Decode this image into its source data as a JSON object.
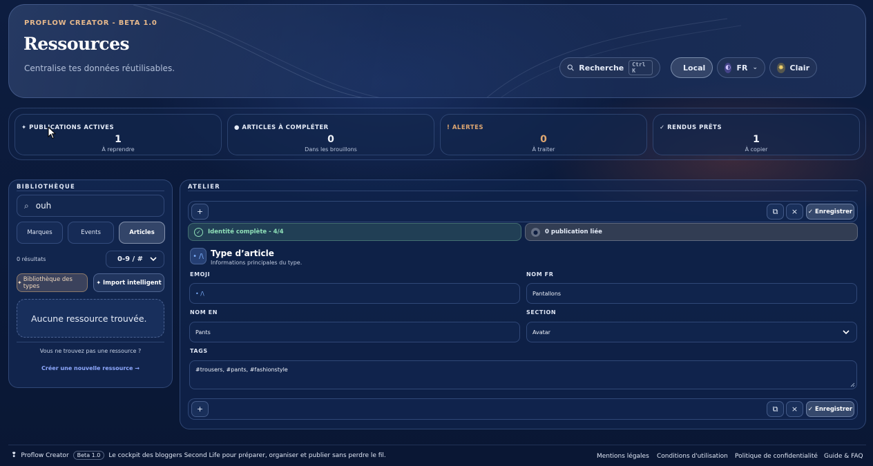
{
  "header": {
    "eyebrow": "PROFLOW CREATOR - BETA 1.0",
    "title": "Ressources",
    "subtitle": "Centralise tes données réutilisables.",
    "search_label": "Recherche",
    "search_shortcut": "Ctrl K",
    "mode_label": "Local",
    "lang_label": "FR",
    "theme_label": "Clair"
  },
  "stats": [
    {
      "label": "PUBLICATIONS ACTIVES",
      "value": "1",
      "sub": "À reprendre",
      "icon": "sparkle-icon",
      "color": "#f1f4fa"
    },
    {
      "label": "ARTICLES À COMPLÉTER",
      "value": "0",
      "sub": "Dans les brouillons",
      "icon": "info-icon",
      "color": "#f1f4fa"
    },
    {
      "label": "ALERTES",
      "value": "0",
      "sub": "À traiter",
      "icon": "alert-icon",
      "color": "#e0a872"
    },
    {
      "label": "RENDUS PRÊTS",
      "value": "1",
      "sub": "À copier",
      "icon": "check-icon",
      "color": "#f1f4fa"
    }
  ],
  "library": {
    "title": "BIBLIOTHÈQUE",
    "search_value": "ouh",
    "tabs": [
      "Marques",
      "Events",
      "Articles"
    ],
    "active_tab": "Articles",
    "result_count": "0 résultats",
    "sort_value": "0-9 / #",
    "types_button": "Bibliothèque des types",
    "import_button": "Import intelligent",
    "empty_text": "Aucune ressource trouvée.",
    "hint": "Vous ne trouvez pas une ressource ?",
    "create_link": "Créer une nouvelle ressource →"
  },
  "atelier": {
    "title": "ATELIER",
    "add_label": "+",
    "duplicate_label": "⧉",
    "close_label": "×",
    "save_label": "Enregistrer",
    "identity_badge": "Identité complète - 4/4",
    "publication_badge": "0 publication liée",
    "type_icon": "• /\\",
    "type_title": "Type d’article",
    "type_subtitle": "Informations principales du type.",
    "fields": {
      "emoji_label": "EMOJI",
      "emoji_value": "• /\\",
      "name_fr_label": "NOM FR",
      "name_fr_value": "Pantallons",
      "name_en_label": "NOM EN",
      "name_en_value": "Pants",
      "section_label": "SECTION",
      "section_value": "Avatar",
      "tags_label": "TAGS",
      "tags_value": "#trousers, #pants, #fashionstyle"
    }
  },
  "footer": {
    "brand": "Proflow Creator",
    "badge": "Beta 1.0",
    "tagline": "Le cockpit des bloggers Second Life pour préparer, organiser et publier sans perdre le fil.",
    "links": [
      "Mentions légales",
      "Conditions d'utilisation",
      "Politique de confidentialité",
      "Guide & FAQ"
    ]
  },
  "colors": {
    "accent_gold": "#e7b98c",
    "success_green": "#5fd3a0",
    "link_blue": "#8fa9ff"
  }
}
